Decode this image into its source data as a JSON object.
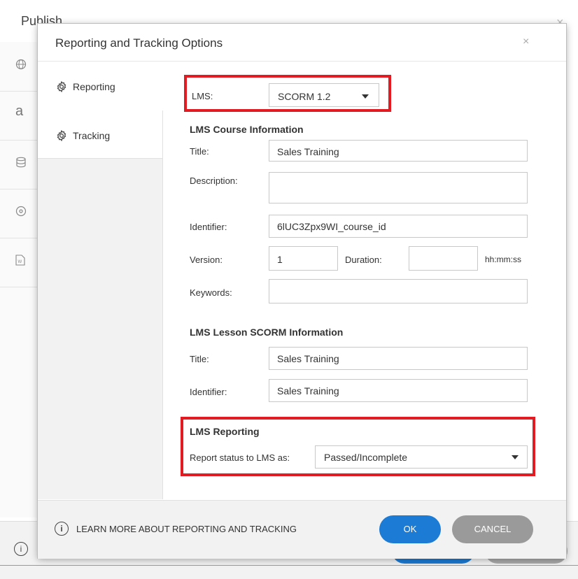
{
  "background_window": {
    "title": "Publish",
    "close_symbol": "×",
    "sidebar_icons": [
      "globe-icon",
      "text-icon",
      "database-icon",
      "disc-icon",
      "word-doc-icon"
    ],
    "dots_label": "...",
    "info_symbol": "i"
  },
  "dialog": {
    "title": "Reporting and Tracking Options",
    "close_symbol": "×"
  },
  "sidebar": {
    "items": [
      {
        "label": "Reporting",
        "icon": "gear-icon",
        "active": true
      },
      {
        "label": "Tracking",
        "icon": "gear-icon",
        "active": false
      }
    ]
  },
  "lms": {
    "label": "LMS:",
    "value": "SCORM 1.2"
  },
  "course_info": {
    "heading": "LMS Course Information",
    "title_label": "Title:",
    "title_value": "Sales Training",
    "description_label": "Description:",
    "description_value": "",
    "identifier_label": "Identifier:",
    "identifier_value": "6lUC3Zpx9WI_course_id",
    "version_label": "Version:",
    "version_value": "1",
    "duration_label": "Duration:",
    "duration_value": "",
    "duration_unit": "hh:mm:ss",
    "keywords_label": "Keywords:",
    "keywords_value": ""
  },
  "lesson_info": {
    "heading": "LMS Lesson SCORM Information",
    "title_label": "Title:",
    "title_value": "Sales Training",
    "identifier_label": "Identifier:",
    "identifier_value": "Sales Training"
  },
  "reporting": {
    "heading": "LMS Reporting",
    "status_label": "Report status to LMS as:",
    "status_value": "Passed/Incomplete"
  },
  "footer": {
    "info_symbol": "i",
    "learn_more": "LEARN MORE ABOUT REPORTING AND TRACKING",
    "ok_label": "OK",
    "cancel_label": "CANCEL"
  },
  "colors": {
    "highlight": "#e21b22",
    "primary_button": "#1c7bd4",
    "secondary_button": "#9a9a9a"
  }
}
